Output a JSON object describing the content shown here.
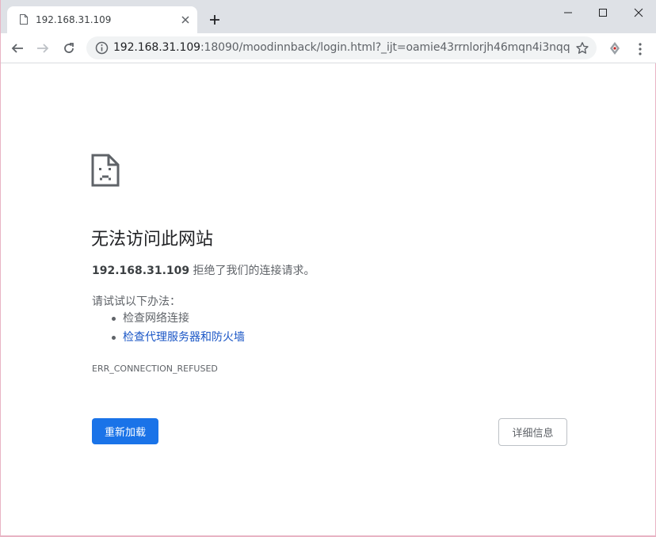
{
  "browser": {
    "tab": {
      "title": "192.168.31.109"
    },
    "address_bar": {
      "host": "192.168.31.109",
      "rest": ":18090/moodinnback/login.html?_ijt=oamie43rrnlorjh46mqn4i3nqq"
    }
  },
  "error_page": {
    "heading": "无法访问此网站",
    "host": "192.168.31.109",
    "description": " 拒绝了我们的连接请求。",
    "suggestions_title": "请试试以下办法：",
    "suggestions": [
      {
        "label": "检查网络连接",
        "link": false
      },
      {
        "label": "检查代理服务器和防火墙",
        "link": true
      }
    ],
    "error_code": "ERR_CONNECTION_REFUSED",
    "reload_label": "重新加载",
    "details_label": "详细信息"
  },
  "colors": {
    "accent": "#1a73e8",
    "link": "#1a56c6",
    "tabstrip": "#dee1e6"
  }
}
